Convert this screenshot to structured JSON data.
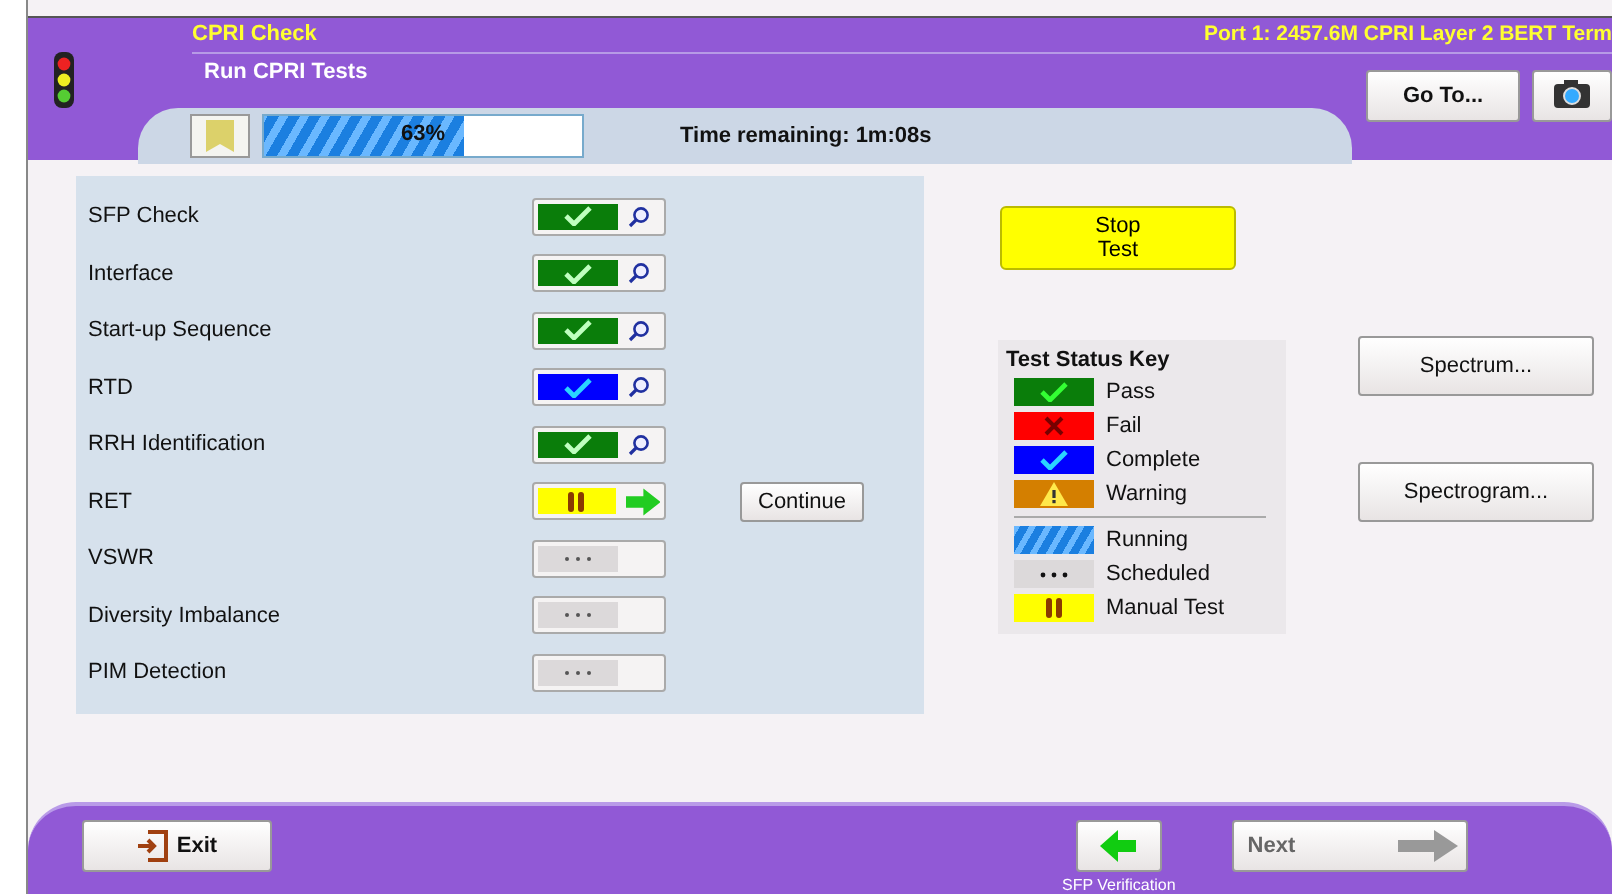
{
  "header": {
    "title": "CPRI Check",
    "subtitle": "Run CPRI Tests",
    "port": "Port 1: 2457.6M CPRI Layer 2 BERT Term",
    "goto": "Go To..."
  },
  "progress": {
    "level": 0.63,
    "label": "63%",
    "time": "Time remaining: 1m:08s"
  },
  "tests": [
    {
      "name": "SFP Check",
      "kind": "pass"
    },
    {
      "name": "Interface",
      "kind": "pass"
    },
    {
      "name": "Start-up Sequence",
      "kind": "pass"
    },
    {
      "name": "RTD",
      "kind": "complete"
    },
    {
      "name": "RRH Identification",
      "kind": "pass"
    },
    {
      "name": "RET",
      "kind": "manual",
      "action": "Continue"
    },
    {
      "name": "VSWR",
      "kind": "scheduled"
    },
    {
      "name": "Diversity Imbalance",
      "kind": "scheduled"
    },
    {
      "name": "PIM Detection",
      "kind": "scheduled"
    }
  ],
  "stop_button": "Stop\nTest",
  "key": {
    "title": "Test Status Key",
    "items": [
      {
        "kind": "pass",
        "label": "Pass"
      },
      {
        "kind": "fail",
        "label": "Fail"
      },
      {
        "kind": "complete",
        "label": "Complete"
      },
      {
        "kind": "warning",
        "label": "Warning"
      },
      {
        "kind": "running",
        "label": "Running"
      },
      {
        "kind": "scheduled",
        "label": "Scheduled"
      },
      {
        "kind": "manual",
        "label": "Manual Test"
      }
    ]
  },
  "side_buttons": [
    "Spectrum...",
    "Spectrogram..."
  ],
  "footer": {
    "exit": "Exit",
    "back_caption": "SFP Verification",
    "next": "Next",
    "next_disabled": true
  }
}
